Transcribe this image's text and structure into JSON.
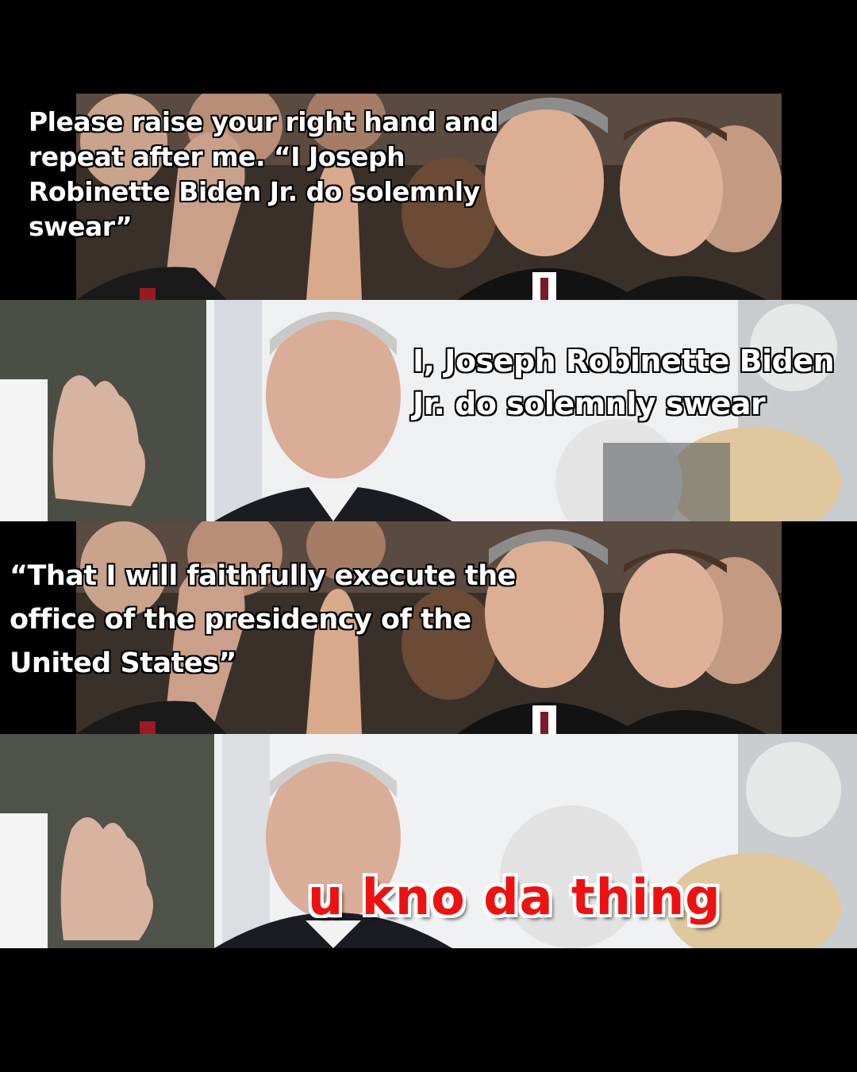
{
  "panels": [
    {
      "scene": "judges",
      "caption": "Please raise your right hand and repeat after me. “I Joseph Robinette Biden Jr. do solemnly swear”"
    },
    {
      "scene": "speaker",
      "caption": "I, Joseph Robinette Biden Jr. do solemnly swear"
    },
    {
      "scene": "judges",
      "caption": "“That I will faithfully execute the office of the presidency of the United States”"
    },
    {
      "scene": "speaker",
      "caption": "u kno da thing",
      "caption_color": "#ee1111",
      "caption_outline": "#ffffff"
    }
  ]
}
